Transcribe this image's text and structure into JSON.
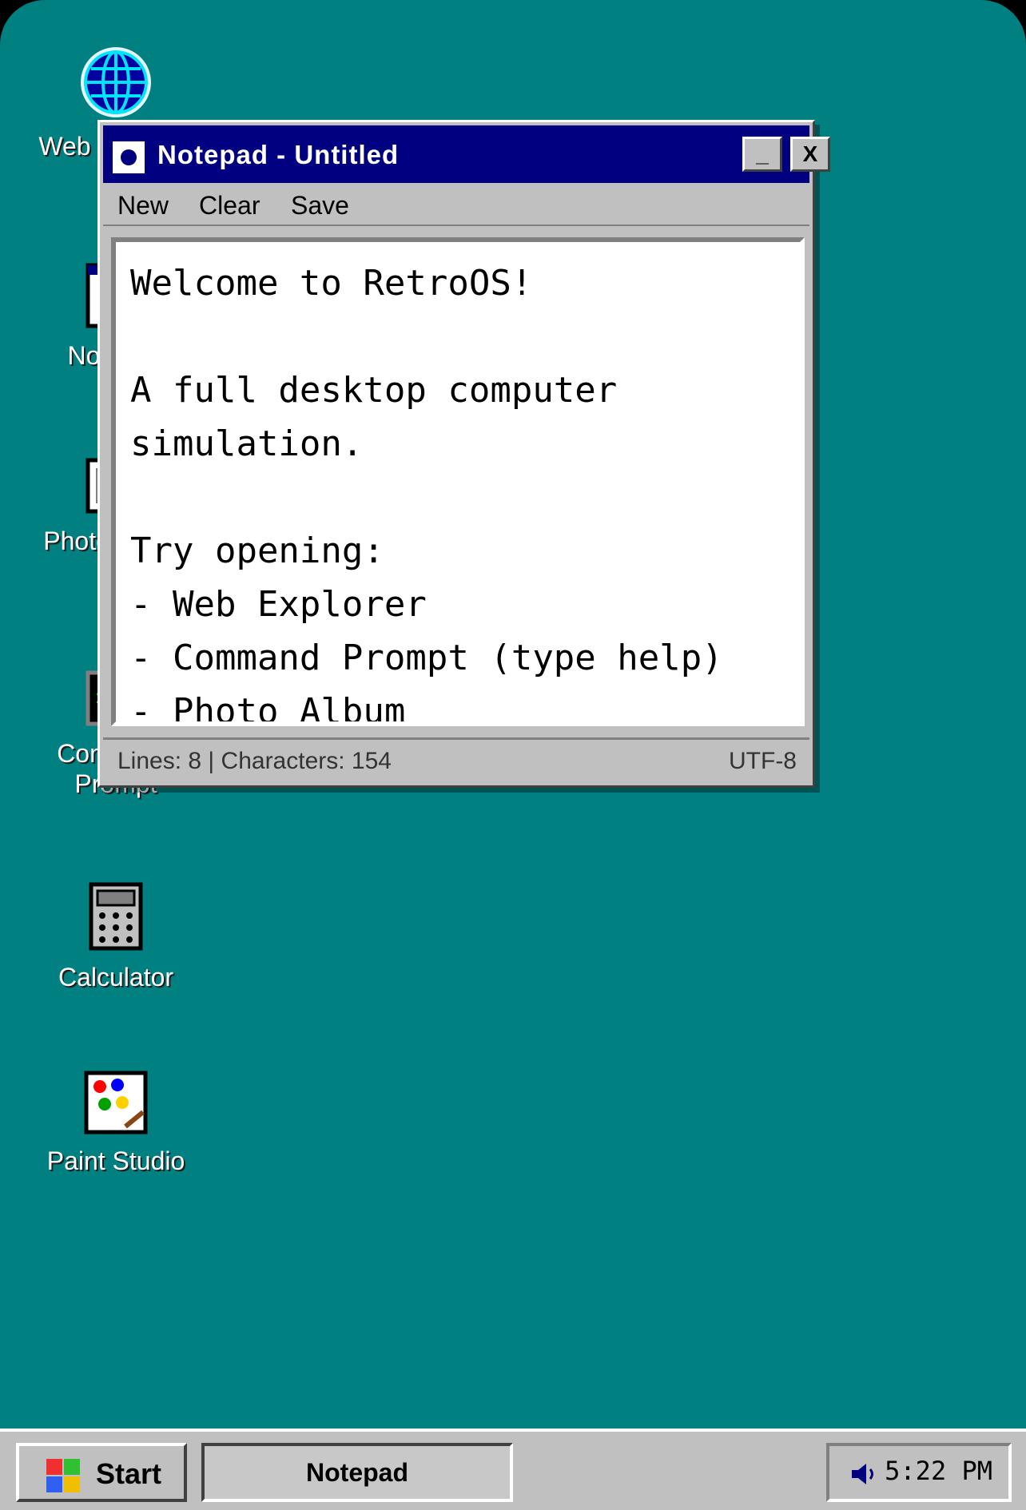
{
  "desktop": {
    "icons": [
      {
        "label": "Web Explorer",
        "icon": "globe-icon"
      },
      {
        "label": "Notepad",
        "icon": "notepad-icon"
      },
      {
        "label": "Photo Album",
        "icon": "photo-icon"
      },
      {
        "label": "Command Prompt",
        "icon": "terminal-icon"
      },
      {
        "label": "Calculator",
        "icon": "calculator-icon"
      },
      {
        "label": "Paint Studio",
        "icon": "palette-icon"
      }
    ]
  },
  "window": {
    "title": "Notepad - Untitled",
    "minimize_label": "_",
    "close_label": "X",
    "menu": [
      "New",
      "Clear",
      "Save"
    ],
    "content": "Welcome to RetroOS!\n\nA full desktop computer simulation.\n\nTry opening:\n- Web Explorer\n- Command Prompt (type help)\n- Photo Album",
    "status_left": "Lines: 8 | Characters: 154",
    "status_right": "UTF-8"
  },
  "taskbar": {
    "start_label": "Start",
    "task_label": "Notepad",
    "clock": "5:22 PM"
  },
  "colors": {
    "desktop": "#008080",
    "titlebar": "#000080",
    "chrome": "#c0c0c0"
  }
}
